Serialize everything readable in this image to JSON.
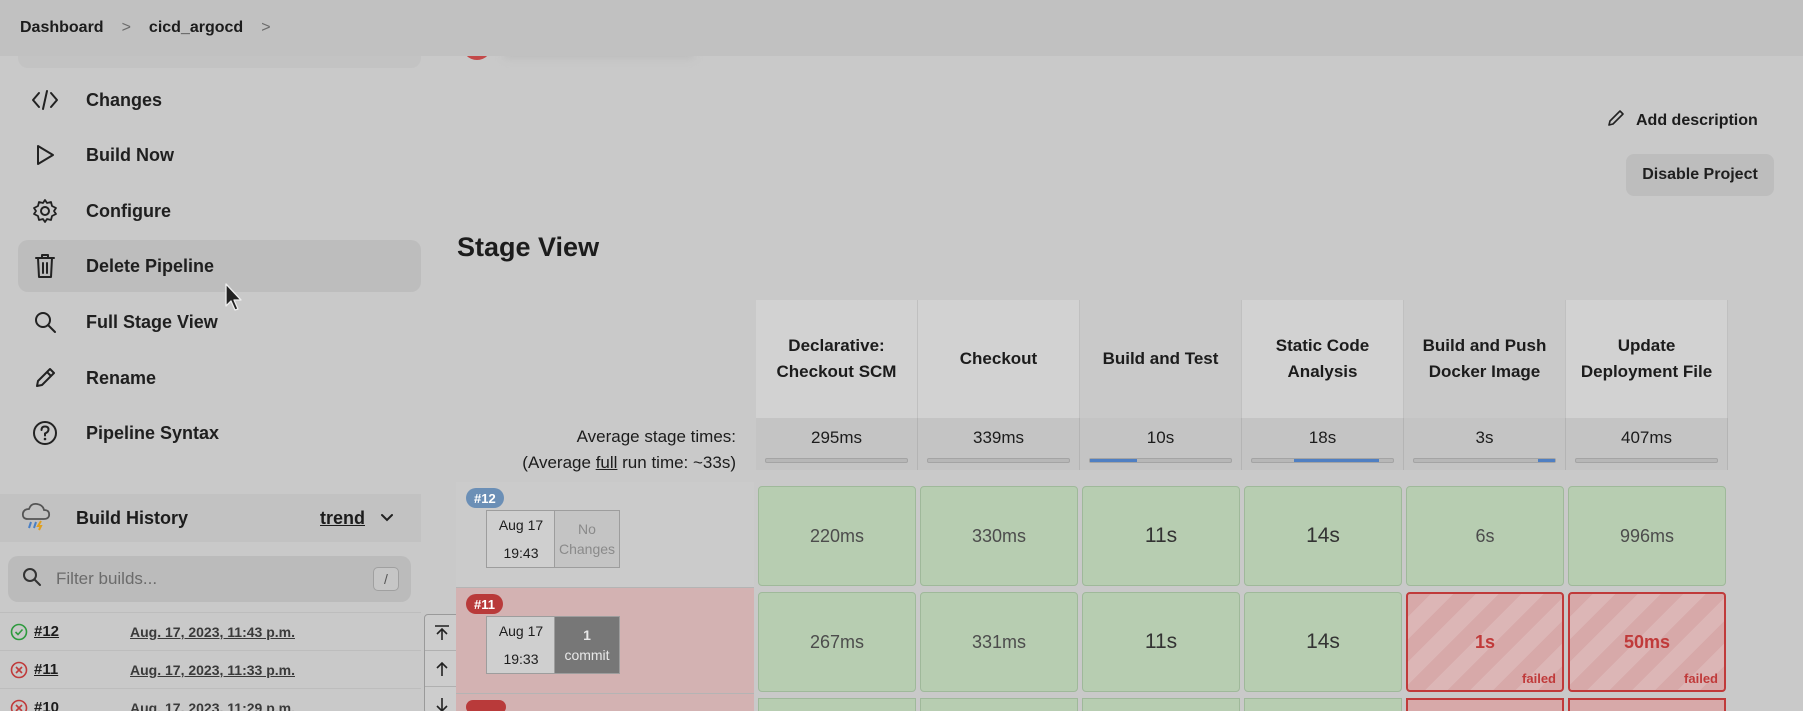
{
  "breadcrumb": {
    "items": [
      "Dashboard",
      "cicd_argocd"
    ],
    "sep": ">"
  },
  "sidebar": {
    "items": [
      {
        "label": "Changes",
        "icon": "code-icon"
      },
      {
        "label": "Build Now",
        "icon": "play-icon"
      },
      {
        "label": "Configure",
        "icon": "gear-icon"
      },
      {
        "label": "Delete Pipeline",
        "icon": "trash-icon"
      },
      {
        "label": "Full Stage View",
        "icon": "search-icon"
      },
      {
        "label": "Rename",
        "icon": "pencil-icon"
      },
      {
        "label": "Pipeline Syntax",
        "icon": "help-icon"
      }
    ]
  },
  "build_history": {
    "title": "Build History",
    "trend": "trend",
    "filter_placeholder": "Filter builds...",
    "shortcut": "/",
    "builds": [
      {
        "num": "#12",
        "date": "Aug. 17, 2023, 11:43 p.m.",
        "status": "success"
      },
      {
        "num": "#11",
        "date": "Aug. 17, 2023, 11:33 p.m.",
        "status": "failed"
      },
      {
        "num": "#10",
        "date": "Aug. 17, 2023, 11:29 p.m.",
        "status": "failed"
      }
    ]
  },
  "main": {
    "add_description": "Add description",
    "disable_project": "Disable Project",
    "stage_view_title": "Stage View"
  },
  "stage_view": {
    "avg_label": "Average stage times:",
    "avg_run_prefix": "(Average ",
    "avg_run_full": "full",
    "avg_run_suffix": " run time: ~33s)",
    "stages": [
      {
        "name": "Declarative: Checkout SCM",
        "avg": "295ms",
        "bar_fill": 0.0
      },
      {
        "name": "Checkout",
        "avg": "339ms",
        "bar_fill": 0.0
      },
      {
        "name": "Build and Test",
        "avg": "10s",
        "bar_fill": 0.33
      },
      {
        "name": "Static Code Analysis",
        "avg": "18s",
        "bar_fill": 0.6
      },
      {
        "name": "Build and Push Docker Image",
        "avg": "3s",
        "bar_fill": 0.12
      },
      {
        "name": "Update Deployment File",
        "avg": "407ms",
        "bar_fill": 0.0
      }
    ],
    "runs": [
      {
        "badge": "#12",
        "date": "Aug 17",
        "time": "19:43",
        "changes": "No Changes",
        "changes_kind": "none",
        "status": "ok",
        "cells": [
          {
            "value": "220ms",
            "status": "ok"
          },
          {
            "value": "330ms",
            "status": "ok"
          },
          {
            "value": "11s",
            "status": "ok"
          },
          {
            "value": "14s",
            "status": "ok"
          },
          {
            "value": "6s",
            "status": "ok"
          },
          {
            "value": "996ms",
            "status": "ok"
          }
        ]
      },
      {
        "badge": "#11",
        "date": "Aug 17",
        "time": "19:33",
        "changes_count": "1",
        "changes_word": "commit",
        "changes_kind": "commit",
        "status": "bad",
        "cells": [
          {
            "value": "267ms",
            "status": "ok"
          },
          {
            "value": "331ms",
            "status": "ok"
          },
          {
            "value": "11s",
            "status": "ok"
          },
          {
            "value": "14s",
            "status": "ok"
          },
          {
            "value": "1s",
            "status": "fail",
            "label": "failed"
          },
          {
            "value": "50ms",
            "status": "fail",
            "label": "failed"
          }
        ]
      }
    ]
  },
  "colors": {
    "success": "#2e9a3e",
    "failure": "#c03a3a",
    "progress": "#4f7fc2"
  }
}
